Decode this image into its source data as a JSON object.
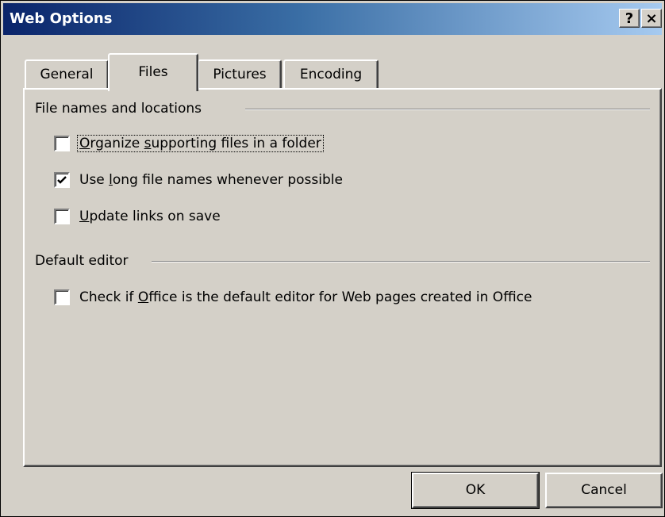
{
  "window": {
    "title": "Web Options",
    "help_label": "?",
    "close_label": "×"
  },
  "tabs": [
    {
      "label": "General",
      "selected": false
    },
    {
      "label": "Files",
      "selected": true
    },
    {
      "label": "Pictures",
      "selected": false
    },
    {
      "label": "Encoding",
      "selected": false
    }
  ],
  "file_names_group": {
    "label": "File names and locations",
    "options": [
      {
        "pre": "",
        "mnemonic": "O",
        "post": "rganize ",
        "mnemonic2": "",
        "rest": "supporting files in a folder",
        "checked": false,
        "focused": true
      },
      {
        "pre": "Use ",
        "mnemonic": "l",
        "post": "ong file names whenever possible",
        "checked": true,
        "focused": false
      },
      {
        "pre": "",
        "mnemonic": "U",
        "post": "pdate links on save",
        "checked": false,
        "focused": false
      }
    ]
  },
  "default_editor_group": {
    "label": "Default editor",
    "options": [
      {
        "pre": "Check if ",
        "mnemonic": "O",
        "post": "ffice is the default editor for Web pages created in Office",
        "checked": false,
        "focused": false
      }
    ]
  },
  "buttons": {
    "ok": "OK",
    "cancel": "Cancel"
  }
}
